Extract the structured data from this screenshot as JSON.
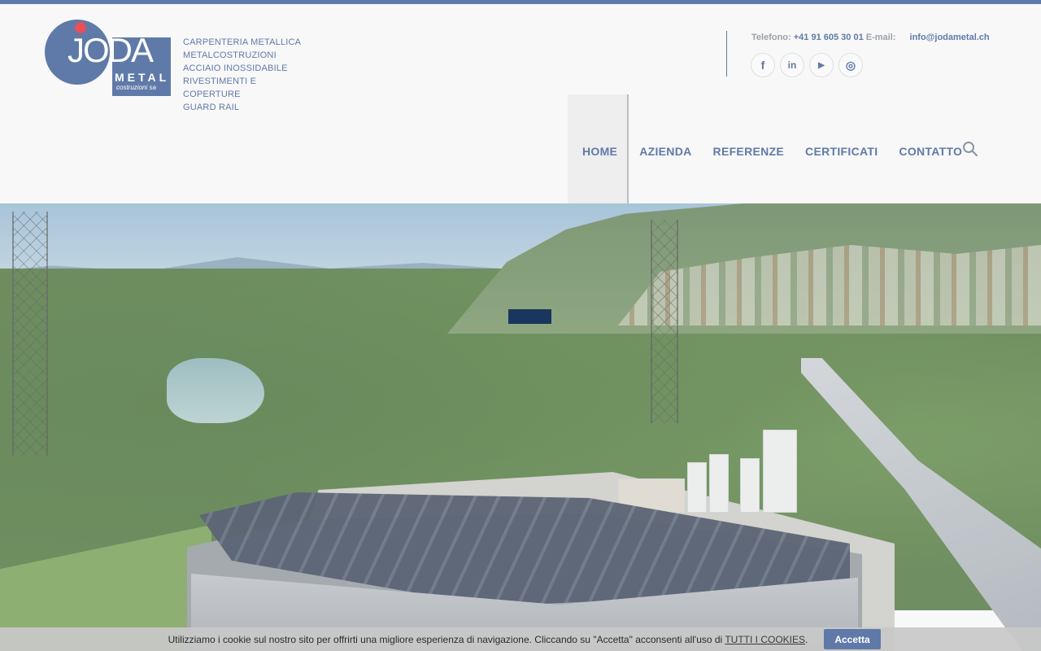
{
  "brand": {
    "logo_main": "JODA",
    "logo_metal": "METAL",
    "logo_sub": "costruzioni sa",
    "taglines": [
      "CARPENTERIA METALLICA",
      "METALCOSTRUZIONI",
      "ACCIAIO INOSSIDABILE",
      "RIVESTIMENTI E COPERTURE",
      "GUARD RAIL"
    ]
  },
  "contact": {
    "phone_label": "Telefono:",
    "phone": "+41 91 605 30 01",
    "email_label": "E-mail:",
    "email": "info@jodametal.ch"
  },
  "socials": [
    {
      "name": "facebook-icon",
      "glyph": "f"
    },
    {
      "name": "linkedin-icon",
      "glyph": "in"
    },
    {
      "name": "youtube-icon",
      "glyph": "▶"
    },
    {
      "name": "instagram-icon",
      "glyph": "◎"
    }
  ],
  "nav": {
    "items": [
      "HOME",
      "AZIENDA",
      "REFERENZE",
      "CERTIFICATI",
      "CONTATTO"
    ],
    "active": "HOME"
  },
  "cookie": {
    "text": "Utilizziamo i cookie sul nostro sito per offrirti una migliore esperienza di navigazione. Cliccando su \"Accetta\" acconsenti all'uso di",
    "link": "TUTTI I COOKIES",
    "after": ".",
    "accept_label": "Accetta"
  },
  "colors": {
    "brand": "#5f7aa8",
    "accent_dot": "#e8505b"
  }
}
